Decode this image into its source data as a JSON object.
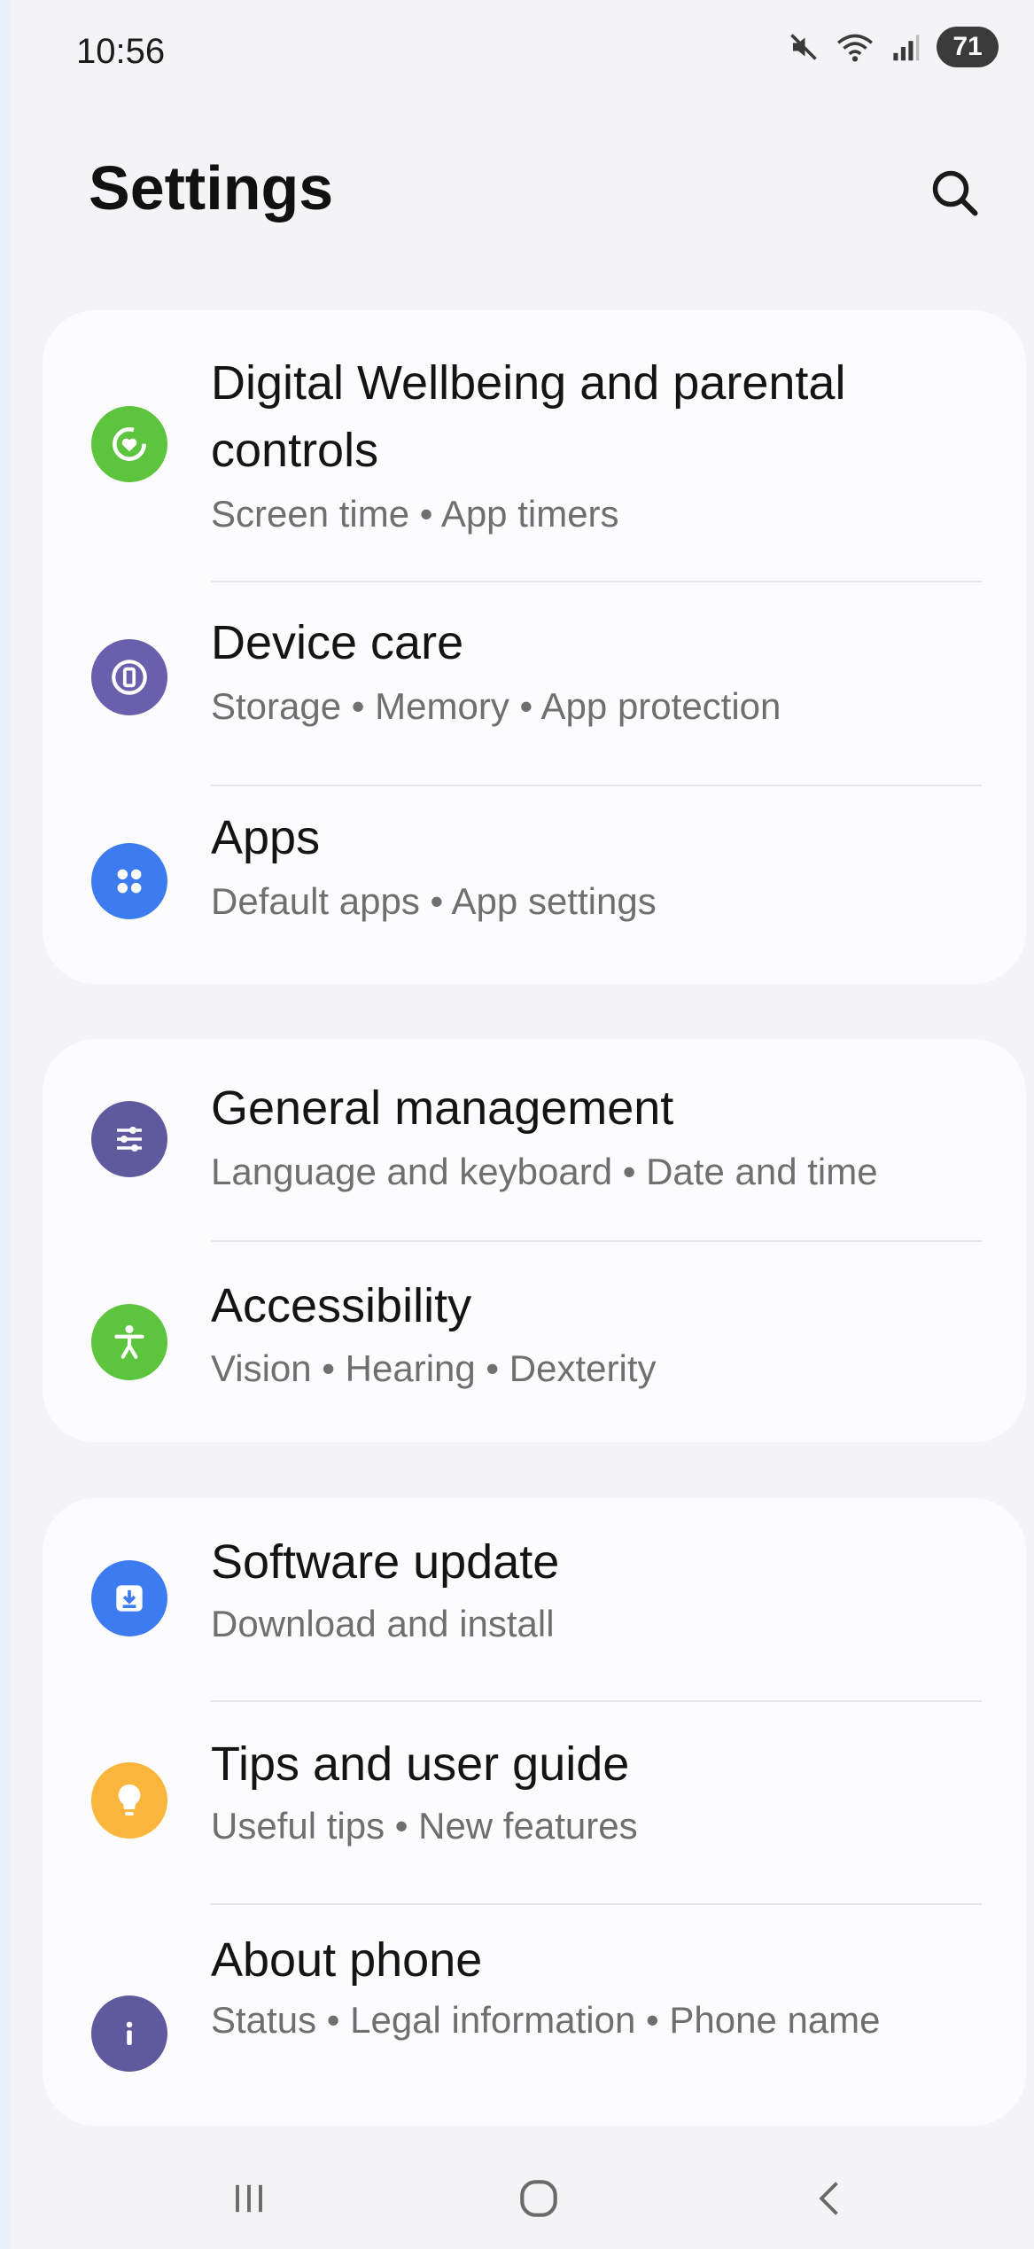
{
  "status": {
    "time": "10:56",
    "battery": "71",
    "icons": [
      "mute-icon",
      "wifi-icon",
      "signal-icon"
    ]
  },
  "header": {
    "title": "Settings",
    "search_icon": "search-icon"
  },
  "groups": [
    {
      "items": [
        {
          "title": "Digital Wellbeing and parental controls",
          "subtitle": "Screen time  •  App timers",
          "icon": "wellbeing-icon",
          "color": "#5cc43d"
        },
        {
          "title": "Device care",
          "subtitle": "Storage  •  Memory  •  App protection",
          "icon": "device-care-icon",
          "color": "#6a5fad"
        },
        {
          "title": "Apps",
          "subtitle": "Default apps  •  App settings",
          "icon": "apps-icon",
          "color": "#3d7bf0"
        }
      ]
    },
    {
      "items": [
        {
          "title": "General management",
          "subtitle": "Language and keyboard  •  Date and time",
          "icon": "sliders-icon",
          "color": "#5f5a9e"
        },
        {
          "title": "Accessibility",
          "subtitle": "Vision  •  Hearing  •  Dexterity",
          "icon": "accessibility-icon",
          "color": "#5cc43d"
        }
      ]
    },
    {
      "items": [
        {
          "title": "Software update",
          "subtitle": "Download and install",
          "icon": "download-icon",
          "color": "#3d7bf0"
        },
        {
          "title": "Tips and user guide",
          "subtitle": "Useful tips  •  New features",
          "icon": "lightbulb-icon",
          "color": "#f9b53c"
        },
        {
          "title": "About phone",
          "subtitle": "Status  •  Legal information  •  Phone name",
          "icon": "info-icon",
          "color": "#5f5a9e"
        }
      ]
    }
  ],
  "nav": [
    "recents-icon",
    "home-icon",
    "back-icon"
  ]
}
